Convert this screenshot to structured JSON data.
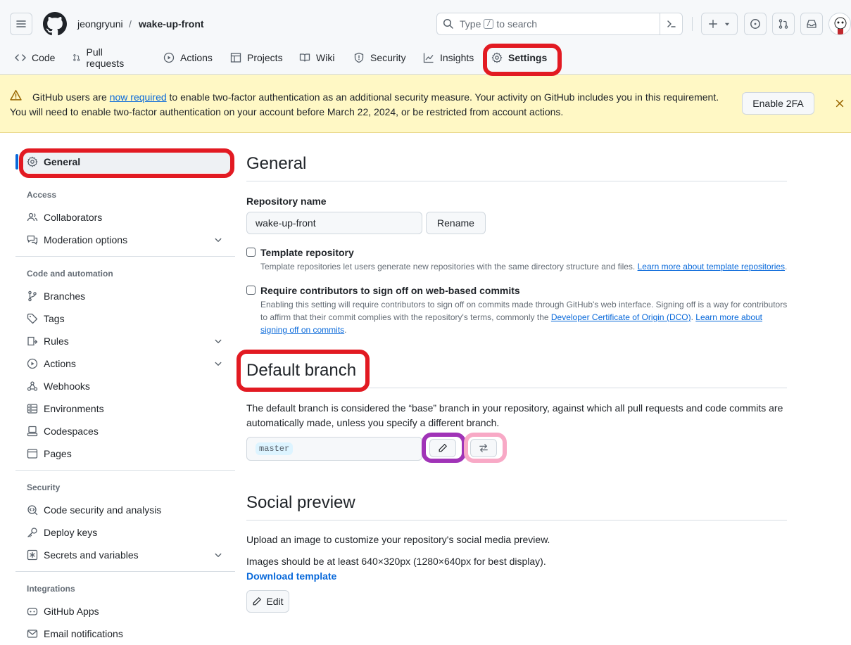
{
  "header": {
    "owner": "jeongryuni",
    "separator": "/",
    "repo": "wake-up-front",
    "search": {
      "prefix": "Type",
      "key": "/",
      "suffix": "to search"
    }
  },
  "tabs": [
    {
      "label": "Code",
      "icon": "code-icon"
    },
    {
      "label": "Pull requests",
      "icon": "git-pull-request-icon"
    },
    {
      "label": "Actions",
      "icon": "play-icon"
    },
    {
      "label": "Projects",
      "icon": "table-icon"
    },
    {
      "label": "Wiki",
      "icon": "book-icon"
    },
    {
      "label": "Security",
      "icon": "shield-icon"
    },
    {
      "label": "Insights",
      "icon": "graph-icon"
    },
    {
      "label": "Settings",
      "icon": "gear-icon",
      "active": true
    }
  ],
  "banner": {
    "text_before": "GitHub users are ",
    "link": "now required",
    "text_after": " to enable two-factor authentication as an additional security measure. Your activity on GitHub includes you in this requirement. You will need to enable two-factor authentication on your account before March 22, 2024, or be restricted from account actions.",
    "button": "Enable 2FA"
  },
  "sidebar": {
    "general": "General",
    "access_heading": "Access",
    "collaborators": "Collaborators",
    "moderation": "Moderation options",
    "code_heading": "Code and automation",
    "branches": "Branches",
    "tags": "Tags",
    "rules": "Rules",
    "actions": "Actions",
    "webhooks": "Webhooks",
    "environments": "Environments",
    "codespaces": "Codespaces",
    "pages": "Pages",
    "security_heading": "Security",
    "code_security": "Code security and analysis",
    "deploy_keys": "Deploy keys",
    "secrets": "Secrets and variables",
    "integrations_heading": "Integrations",
    "github_apps": "GitHub Apps",
    "email_notifications": "Email notifications"
  },
  "main": {
    "general_title": "General",
    "repo_name_label": "Repository name",
    "repo_name_value": "wake-up-front",
    "rename_button": "Rename",
    "template_label": "Template repository",
    "template_note": "Template repositories let users generate new repositories with the same directory structure and files.",
    "template_link": "Learn more about template repositories",
    "signoff_label": "Require contributors to sign off on web-based commits",
    "signoff_note": "Enabling this setting will require contributors to sign off on commits made through GitHub's web interface. Signing off is a way for contributors to affirm that their commit complies with the repository's terms, commonly the ",
    "signoff_link1": "Developer Certificate of Origin (DCO)",
    "signoff_link2": "Learn more about signing off on commits",
    "default_branch_title": "Default branch",
    "default_branch_desc": "The default branch is considered the “base” branch in your repository, against which all pull requests and code commits are automatically made, unless you specify a different branch.",
    "branch_name": "master",
    "social_title": "Social preview",
    "social_desc1": "Upload an image to customize your repository's social media preview.",
    "social_desc2": "Images should be at least 640×320px (1280×640px for best display).",
    "download_template": "Download template",
    "edit_button": "Edit"
  },
  "colors": {
    "accent": "#0969da",
    "annotation_red": "#e21a22",
    "annotation_purple": "#a033b7",
    "annotation_pink": "#f8a9c6",
    "banner_bg": "#fff8c5"
  }
}
